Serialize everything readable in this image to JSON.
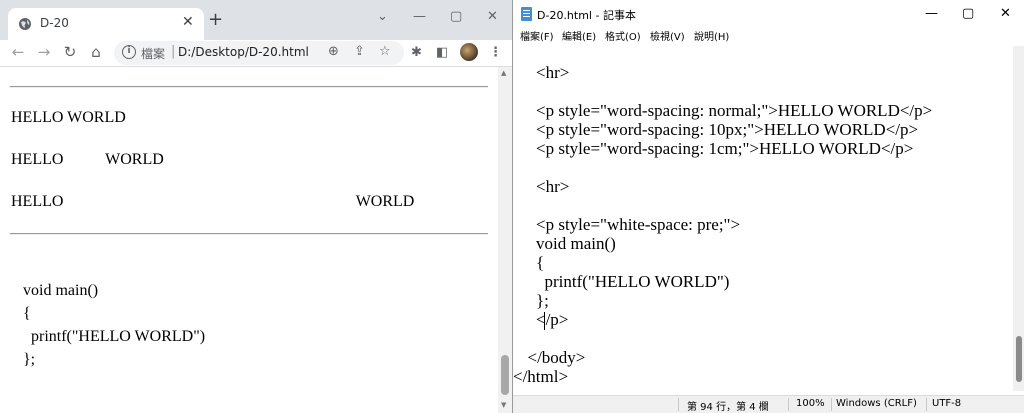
{
  "browser": {
    "tab_title": "D-20",
    "new_tab_label": "+",
    "window_controls": {
      "dropdown": "⌄",
      "minimize": "—",
      "maximize": "▢",
      "close": "✕"
    },
    "nav": {
      "back": "←",
      "forward": "→",
      "reload": "↻",
      "home": "⌂"
    },
    "omnibox": {
      "info": "i",
      "scheme_label": "檔案",
      "separator": "|",
      "url": "D:/Desktop/D-20.html"
    },
    "toolbar_icons": {
      "zoom": "⊕",
      "share": "⇪",
      "bookmark": "☆",
      "extensions": "✱",
      "sidepanel": "◧",
      "menu": "⋮"
    },
    "page": {
      "p1": "HELLO WORLD",
      "p2": "HELLO   WORLD",
      "p3": "HELLO       WORLD",
      "pre_lines": [
        "   void main()",
        "   {",
        "     printf(\"HELLO WORLD\")",
        "   };"
      ]
    }
  },
  "notepad": {
    "title": "D-20.html - 記事本",
    "window_controls": {
      "minimize": "—",
      "maximize": "▢",
      "close": "✕"
    },
    "menu": [
      "檔案(F)",
      "編輯(E)",
      "格式(O)",
      "檢視(V)",
      "說明(H)"
    ],
    "code_lines": [
      "    <hr>",
      "",
      "    <p style=\"word-spacing: normal;\">HELLO WORLD</p>",
      "    <p style=\"word-spacing: 10px;\">HELLO WORLD</p>",
      "    <p style=\"word-spacing: 1cm;\">HELLO WORLD</p>",
      "",
      "    <hr>",
      "",
      "    <p style=\"white-space: pre;\">",
      "    void main()",
      "    {",
      "      printf(\"HELLO WORLD\")",
      "    };",
      "    </p>",
      "",
      "  </body>",
      "</html>"
    ],
    "status": {
      "position": "第 94 行，第 4 欄",
      "zoom": "100%",
      "line_ending": "Windows (CRLF)",
      "encoding": "UTF-8"
    }
  }
}
